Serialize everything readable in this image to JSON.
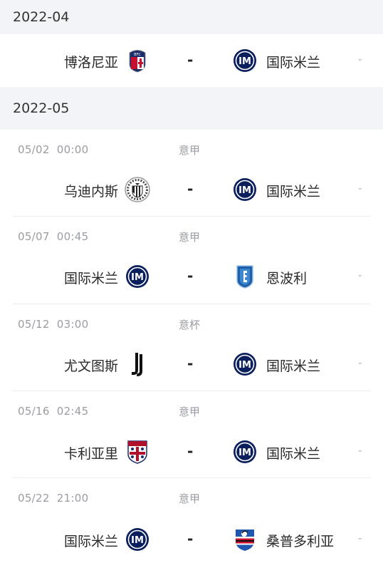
{
  "months": [
    {
      "label": "2022-04"
    },
    {
      "label": "2022-05"
    }
  ],
  "matches": [
    {
      "date": "",
      "time": "",
      "competition": "",
      "home": "博洛尼亚",
      "home_logo": "bologna-crest-icon",
      "score": "-",
      "away": "国际米兰",
      "away_logo": "inter-crest-icon",
      "extra": "-"
    },
    {
      "date": "05/02",
      "time": "00:00",
      "competition": "意甲",
      "home": "乌迪内斯",
      "home_logo": "udinese-crest-icon",
      "score": "-",
      "away": "国际米兰",
      "away_logo": "inter-crest-icon",
      "extra": "-"
    },
    {
      "date": "05/07",
      "time": "00:45",
      "competition": "意甲",
      "home": "国际米兰",
      "home_logo": "inter-crest-icon",
      "score": "-",
      "away": "恩波利",
      "away_logo": "empoli-crest-icon",
      "extra": "-"
    },
    {
      "date": "05/12",
      "time": "03:00",
      "competition": "意杯",
      "home": "尤文图斯",
      "home_logo": "juventus-crest-icon",
      "score": "-",
      "away": "国际米兰",
      "away_logo": "inter-crest-icon",
      "extra": "-"
    },
    {
      "date": "05/16",
      "time": "02:45",
      "competition": "意甲",
      "home": "卡利亚里",
      "home_logo": "cagliari-crest-icon",
      "score": "-",
      "away": "国际米兰",
      "away_logo": "inter-crest-icon",
      "extra": "-"
    },
    {
      "date": "05/22",
      "time": "21:00",
      "competition": "意甲",
      "home": "国际米兰",
      "home_logo": "inter-crest-icon",
      "score": "-",
      "away": "桑普多利亚",
      "away_logo": "sampdoria-crest-icon",
      "extra": "-"
    }
  ],
  "colors": {
    "header_bg": "#f3f4f8",
    "meta_text": "#9a9ca3",
    "inter_navy": "#0b1f5c",
    "bologna_red": "#c8102e",
    "bologna_blue": "#1a2d6b"
  }
}
